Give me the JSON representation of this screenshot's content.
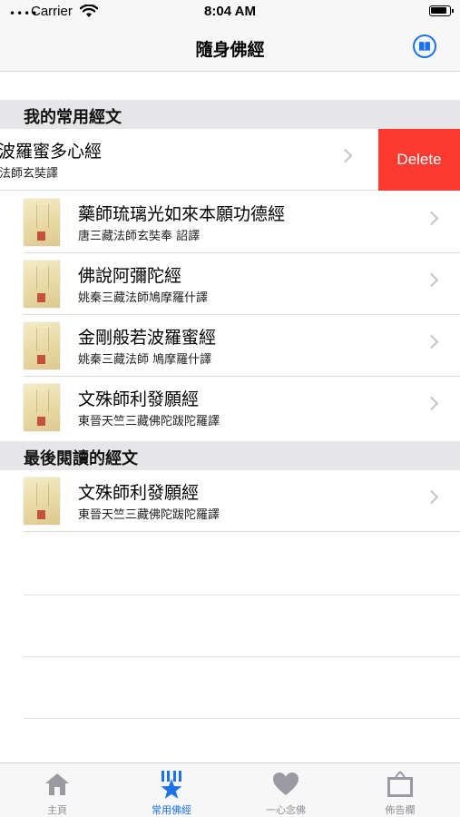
{
  "status_bar": {
    "signal": "••••",
    "carrier": "Carrier",
    "time": "8:04 AM",
    "icons": [
      "wifi-icon",
      "battery-icon"
    ]
  },
  "nav": {
    "title": "隨身佛經",
    "right_icon": "book-icon",
    "accent_color": "#1a73e8"
  },
  "sections": {
    "favorites": {
      "header": "我的常用經文",
      "swiped_row": {
        "title": "般若波羅蜜多心經",
        "subtitle": "唐三藏法師玄奘譯",
        "delete_label": "Delete"
      },
      "rows": [
        {
          "title": "藥師琉璃光如來本願功德經",
          "subtitle": "唐三藏法師玄奘奉 詔譯"
        },
        {
          "title": "佛說阿彌陀經",
          "subtitle": "姚秦三藏法師鳩摩羅什譯"
        },
        {
          "title": "金剛般若波羅蜜經",
          "subtitle": "姚秦三藏法師 鳩摩羅什譯"
        },
        {
          "title": "文殊師利發願經",
          "subtitle": "東晉天竺三藏佛陀跋陀羅譯"
        }
      ]
    },
    "recent": {
      "header": "最後閱讀的經文",
      "rows": [
        {
          "title": "文殊師利發願經",
          "subtitle": "東晉天竺三藏佛陀跋陀羅譯"
        }
      ]
    }
  },
  "tab_bar": {
    "tabs": [
      {
        "label": "主頁",
        "icon": "home-icon",
        "active": false
      },
      {
        "label": "常用佛經",
        "icon": "star-bookmark-icon",
        "active": true
      },
      {
        "label": "一心念佛",
        "icon": "heart-icon",
        "active": false
      },
      {
        "label": "佈告欄",
        "icon": "noticeboard-icon",
        "active": false
      }
    ],
    "active_color": "#1a73e8",
    "inactive_color": "#8e8e93"
  },
  "colors": {
    "delete": "#fb3b2f",
    "section_bg": "#e6e6e8"
  }
}
